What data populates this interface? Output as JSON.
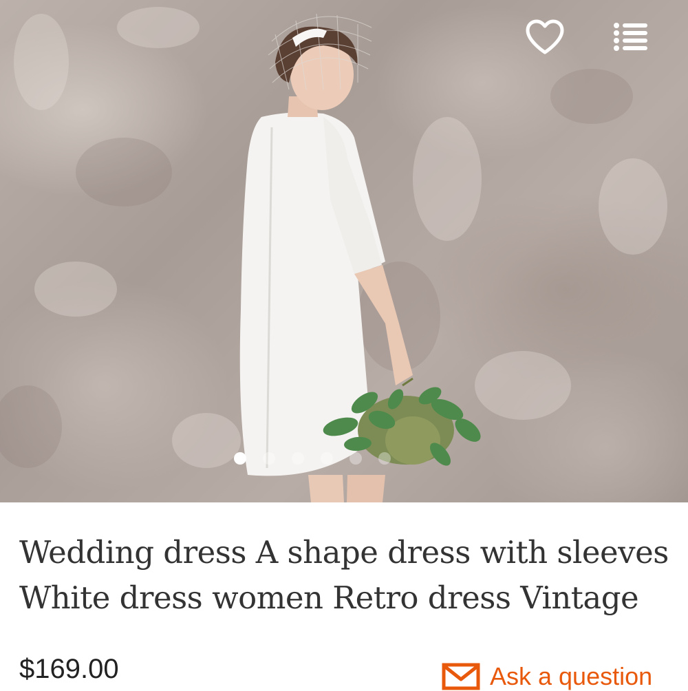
{
  "listing": {
    "image": {
      "alt_semantic": "product-photo",
      "carousel_dots": 6,
      "active_dot": 0
    },
    "title_line1": "Wedding dress A shape dress with sleeves",
    "title_line2": "White dress women Retro dress Vintage",
    "price": "$169.00",
    "ask_question_label": "Ask a question"
  },
  "icons": {
    "favorite": "heart-icon",
    "menu": "list-menu-icon",
    "message": "envelope-icon"
  },
  "colors": {
    "accent": "#e8590c",
    "title_text": "#333333",
    "price_text": "#222222",
    "icon_white": "#ffffff"
  }
}
